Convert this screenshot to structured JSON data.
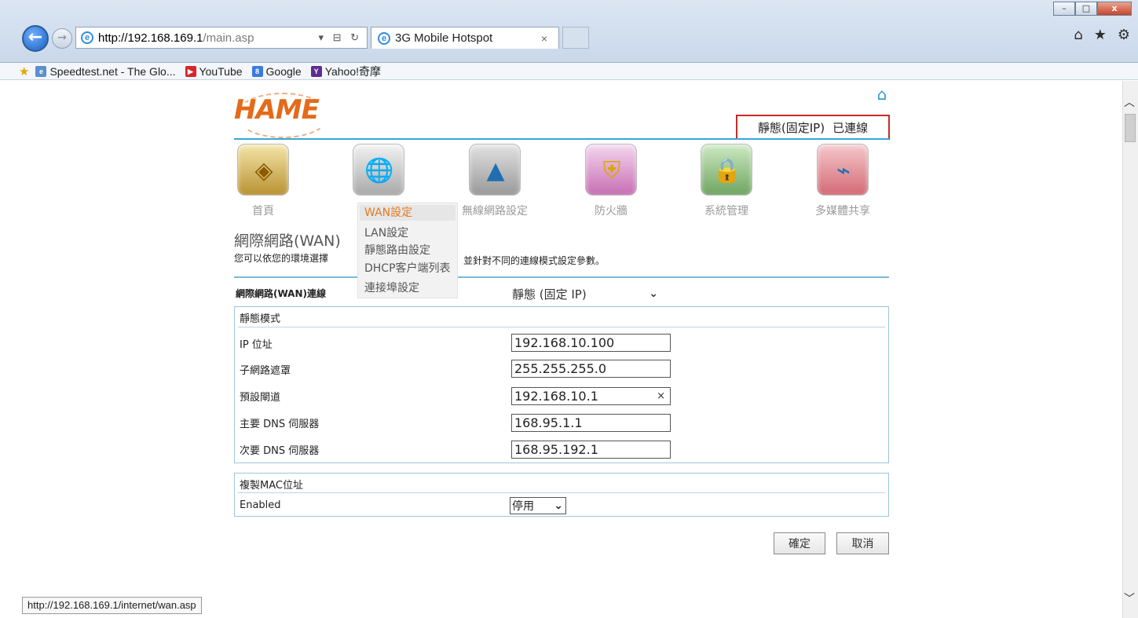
{
  "browser": {
    "address_host": "http://192.168.169.1",
    "address_path": "/main.asp",
    "address_tools": "▾ ⊟ ↻",
    "tab_title": "3G Mobile Hotspot",
    "tab_close": "×",
    "window_controls": [
      "–",
      "□",
      "x"
    ],
    "toolbar_icons": [
      "⌂",
      "★",
      "⚙"
    ],
    "favorites": [
      {
        "label": "Speedtest.net - The Glo...",
        "icon": "page-icon",
        "color": "#5b8fcf"
      },
      {
        "label": "YouTube",
        "icon": "youtube-icon",
        "color": "#d9252a"
      },
      {
        "label": "Google",
        "icon": "google-icon",
        "color": "#3b7be0"
      },
      {
        "label": "Yahoo!奇摩",
        "icon": "yahoo-icon",
        "color": "#5c2d91"
      }
    ],
    "status_url": "http://192.168.169.1/internet/wan.asp"
  },
  "router": {
    "logo": "HAME",
    "status_mode": "靜態(固定IP)",
    "status_conn": "已連線",
    "nav": [
      {
        "label": "首頁",
        "icon": "home-arrow-icon"
      },
      {
        "label": "WAN設定",
        "icon": "globe-check-icon"
      },
      {
        "label": "無線網路設定",
        "icon": "wireless-tower-icon"
      },
      {
        "label": "防火牆",
        "icon": "shield-icon"
      },
      {
        "label": "系統管理",
        "icon": "padlock-icon"
      },
      {
        "label": "多媒體共享",
        "icon": "usb-wireless-icon"
      }
    ],
    "submenu": [
      "WAN設定",
      "LAN設定",
      "靜態路由設定",
      "DHCP客户端列表",
      "連接埠設定"
    ],
    "heading": "網際網路(WAN)",
    "desc_left": "您可以依您的環境選擇",
    "desc_right": "並針對不同的連線模式設定參數。",
    "conn_label": "網際網路(WAN)連線",
    "conn_value": "靜態 (固定 IP)",
    "static_title": "靜態模式",
    "fields": [
      {
        "label": "IP 位址",
        "value": "192.168.10.100"
      },
      {
        "label": "子網路遮罩",
        "value": "255.255.255.0"
      },
      {
        "label": "預設閘道",
        "value": "192.168.10.1"
      },
      {
        "label": "主要 DNS 伺服器",
        "value": "168.95.1.1"
      },
      {
        "label": "次要 DNS 伺服器",
        "value": "168.95.192.1"
      }
    ],
    "mac_title": "複製MAC位址",
    "mac_label": "Enabled",
    "mac_value": "停用",
    "btn_ok": "確定",
    "btn_cancel": "取消"
  },
  "colors": {
    "accent_orange": "#e37a22",
    "accent_blue": "#3aa6d8",
    "status_border": "#c52b2b"
  }
}
